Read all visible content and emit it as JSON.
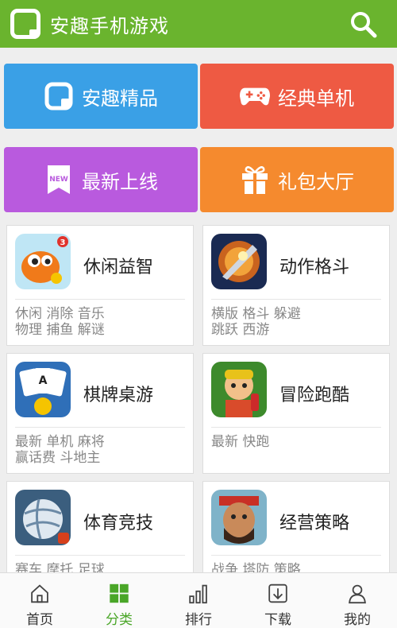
{
  "header": {
    "title": "安趣手机游戏",
    "search_icon": "search-icon"
  },
  "quick_buttons": [
    {
      "label": "安趣精品",
      "icon": "anqu-logo-icon",
      "color": "#3aa0e6"
    },
    {
      "label": "经典单机",
      "icon": "gamepad-icon",
      "color": "#ee5a43"
    },
    {
      "label": "最新上线",
      "icon": "new-ribbon-icon",
      "color": "#b95ade"
    },
    {
      "label": "礼包大厅",
      "icon": "gift-icon",
      "color": "#f58a2e"
    }
  ],
  "categories": [
    {
      "name": "休闲益智",
      "tags": [
        "休闲 消除 音乐",
        "物理 捕鱼 解谜"
      ]
    },
    {
      "name": "动作格斗",
      "tags": [
        "横版 格斗 躲避",
        "跳跃 西游"
      ]
    },
    {
      "name": "棋牌桌游",
      "tags": [
        "最新 单机 麻将",
        "赢话费 斗地主"
      ]
    },
    {
      "name": "冒险跑酷",
      "tags": [
        "最新 快跑",
        ""
      ]
    },
    {
      "name": "体育竞技",
      "tags": [
        "赛车 摩托 足球",
        ""
      ]
    },
    {
      "name": "经营策略",
      "tags": [
        "战争 塔防 策略",
        ""
      ]
    }
  ],
  "bottom_nav": [
    {
      "label": "首页",
      "icon": "home-icon",
      "active": false
    },
    {
      "label": "分类",
      "icon": "grid-icon",
      "active": true
    },
    {
      "label": "排行",
      "icon": "bar-chart-icon",
      "active": false
    },
    {
      "label": "下载",
      "icon": "download-icon",
      "active": false
    },
    {
      "label": "我的",
      "icon": "user-icon",
      "active": false
    }
  ],
  "colors": {
    "header": "#6ab42e",
    "active_nav": "#4aa628"
  }
}
